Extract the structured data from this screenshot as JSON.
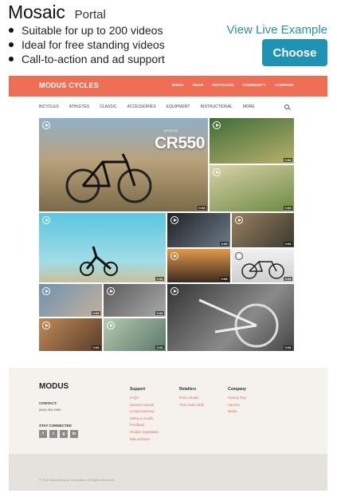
{
  "header": {
    "title": "Mosaic",
    "subtitle": "Portal",
    "features": [
      "Suitable for up to 200 videos",
      "Ideal for free standing videos",
      "Call-to-action and ad support"
    ],
    "live_link": "View Live Example",
    "choose_label": "Choose"
  },
  "preview": {
    "brand": "MODUS CYCLES",
    "top_nav": [
      "BIKES",
      "GEAR",
      "RETAILERS",
      "COMMUNITY",
      "COMPANY"
    ],
    "categories": [
      "BICYCLES",
      "ATHLETES",
      "CLASSIC",
      "ACCESSORIES",
      "EQUIPMENT",
      "INSTRUCTIONAL",
      "MORE"
    ],
    "hero_small": "MODUS",
    "hero_text": "CR550",
    "durations": [
      "0:08",
      "0:08",
      "0:08",
      "0:08",
      "0:08",
      "0:08",
      "0:08",
      "0:08",
      "0:08",
      "0:08",
      "0:08",
      "0:08",
      "0:08"
    ],
    "footer": {
      "brand": "MODUS",
      "contact_label": "CONTACT:",
      "phone": "(800) 892-1965",
      "stay_connected": "STAY CONNECTED",
      "social": [
        "f",
        "t",
        "g",
        "in"
      ],
      "columns": [
        {
          "title": "Support",
          "links": [
            "FAQ's",
            "Owner's manual",
            "Limited warranty",
            "Safety & recalls",
            "Feedback",
            "Product registration",
            "Bike archives"
          ]
        },
        {
          "title": "Retailers",
          "links": [
            "Find a dealer",
            "Trek credit cards"
          ]
        },
        {
          "title": "Company",
          "links": [
            "Factory Tour",
            "Careers",
            "Media"
          ]
        }
      ],
      "copyright": "© 2011 Modus Bicycle Corporation. All Rights Reserved."
    }
  },
  "colors": {
    "accent": "#1e93b4",
    "link": "#2a8fa8",
    "topbar": "#ee6f55",
    "footer_link": "#e36b57"
  }
}
